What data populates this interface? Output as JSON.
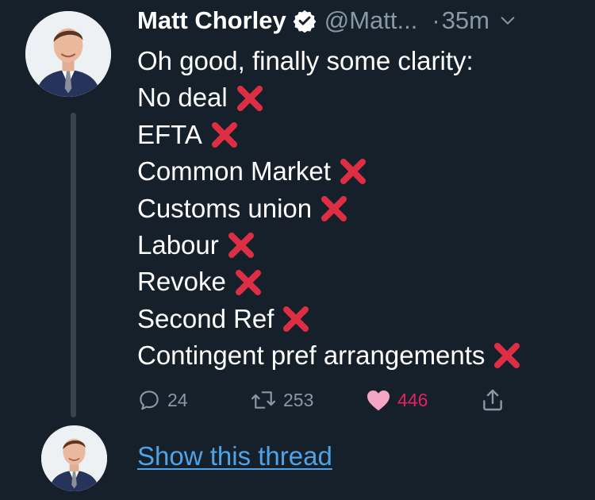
{
  "tweet": {
    "author_name": "Matt Chorley",
    "handle": "@Matt...",
    "separator": "·",
    "time": "35m",
    "verified": true,
    "lines": [
      "Oh good, finally some clarity:",
      "No deal",
      "EFTA",
      "Common Market",
      "Customs union",
      "Labour",
      "Revoke",
      "Second Ref",
      "Contingent pref arrangements"
    ],
    "cross_marker": "cross-mark-icon",
    "actions": {
      "reply_count": "24",
      "retweet_count": "253",
      "like_count": "446",
      "liked": true
    }
  },
  "thread": {
    "show_thread_label": "Show this thread"
  },
  "colors": {
    "background": "#15202b",
    "secondary_text": "#8899a6",
    "link": "#4fa3e6",
    "like": "#e0245e",
    "cross": "#dd2e44",
    "thread_line": "#38444d"
  }
}
